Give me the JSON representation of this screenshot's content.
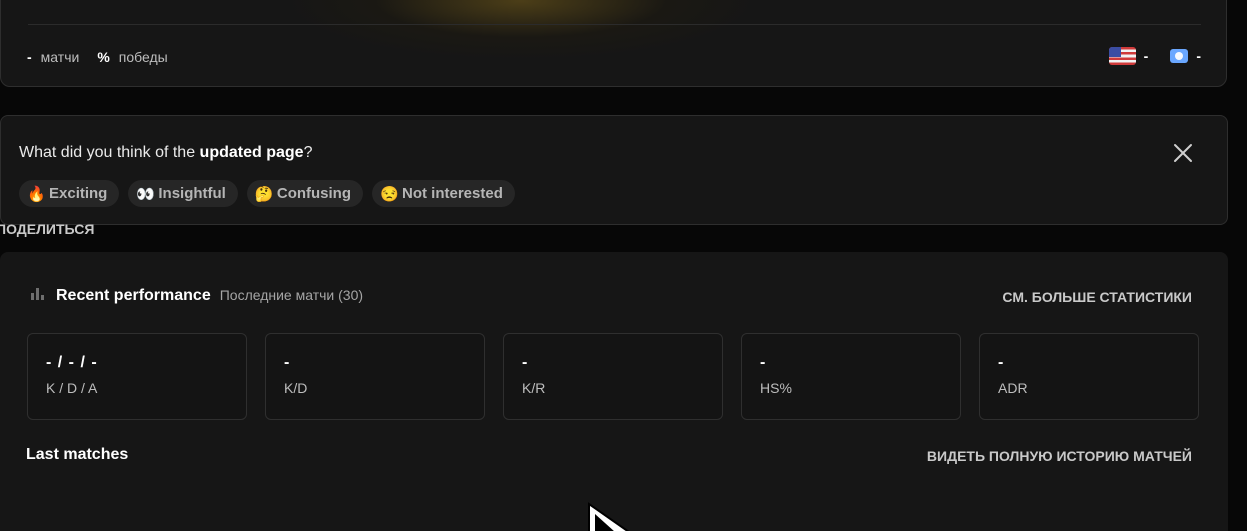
{
  "profile": {
    "matches_value": "-",
    "matches_label": "матчи",
    "wins_value": "%",
    "wins_label": "победы",
    "region1_value": "-",
    "region2_value": "-"
  },
  "feedback": {
    "question_prefix": "What did you think of the ",
    "question_bold": "updated page",
    "question_suffix": "?",
    "options": [
      {
        "emoji": "🔥",
        "label": "Exciting"
      },
      {
        "emoji": "👀",
        "label": "Insightful"
      },
      {
        "emoji": "🤔",
        "label": "Confusing"
      },
      {
        "emoji": "😒",
        "label": "Not interested"
      }
    ]
  },
  "share_label": "ПОДЕЛИТЬСЯ",
  "performance": {
    "title": "Recent performance",
    "subtitle": "Последние матчи (30)",
    "see_more": "СМ. БОЛЬШЕ СТАТИСТИКИ",
    "stats": [
      {
        "value": "- / - / -",
        "label": "K / D / A"
      },
      {
        "value": "-",
        "label": "K/D"
      },
      {
        "value": "-",
        "label": "K/R"
      },
      {
        "value": "-",
        "label": "HS%"
      },
      {
        "value": "-",
        "label": "ADR"
      }
    ]
  },
  "last_matches": {
    "title": "Last matches",
    "full_history": "ВИДЕТЬ ПОЛНУЮ ИСТОРИЮ МАТЧЕЙ"
  },
  "icons": {
    "close": "close-icon",
    "chart": "bar-chart-icon",
    "flag": "us-flag-icon",
    "region": "region-icon"
  }
}
